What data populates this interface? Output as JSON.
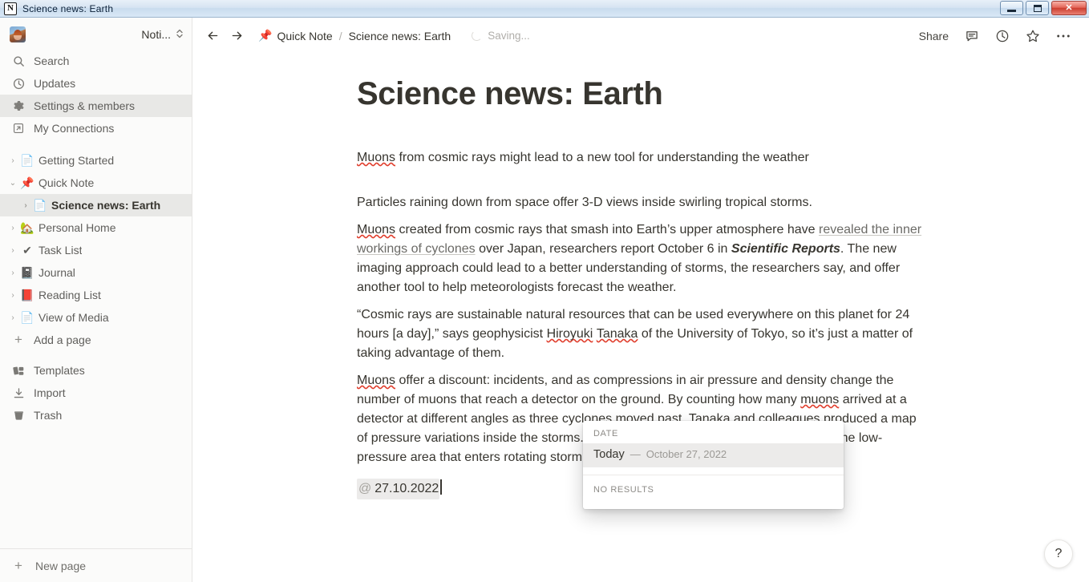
{
  "window": {
    "title": "Science news: Earth",
    "app_icon": "notion-logo-icon",
    "minimize_label": "Minimize",
    "maximize_label": "Restore",
    "close_label": "Close"
  },
  "sidebar": {
    "workspace": {
      "name": "Noti...",
      "avatar": "user-avatar",
      "chevron": "⌃⌄"
    },
    "nav_items": [
      {
        "icon": "search-icon",
        "label": "Search",
        "selected": false
      },
      {
        "icon": "clock-icon",
        "label": "Updates",
        "selected": false
      },
      {
        "icon": "gear-icon",
        "label": "Settings & members",
        "selected": true
      },
      {
        "icon": "link-out-icon",
        "label": "My Connections",
        "selected": false
      }
    ],
    "pages": [
      {
        "icon": "📄",
        "label": "Getting Started",
        "expanded": false,
        "active": false,
        "indented": false
      },
      {
        "icon": "📌",
        "label": "Quick Note",
        "expanded": true,
        "active": false,
        "indented": false
      },
      {
        "icon": "📄",
        "label": "Science news: Earth",
        "expanded": false,
        "active": true,
        "indented": true
      },
      {
        "icon": "🏡",
        "label": "Personal Home",
        "expanded": false,
        "active": false,
        "indented": false
      },
      {
        "icon": "✔",
        "label": "Task List",
        "expanded": false,
        "active": false,
        "indented": false
      },
      {
        "icon": "📓",
        "label": "Journal",
        "expanded": false,
        "active": false,
        "indented": false
      },
      {
        "icon": "📕",
        "label": "Reading List",
        "expanded": false,
        "active": false,
        "indented": false
      },
      {
        "icon": "📄",
        "label": "View of Media",
        "expanded": false,
        "active": false,
        "indented": false
      }
    ],
    "add_page_label": "Add a page",
    "bottom_items": [
      {
        "icon": "templates-icon",
        "label": "Templates"
      },
      {
        "icon": "import-icon",
        "label": "Import"
      },
      {
        "icon": "trash-icon",
        "label": "Trash"
      }
    ],
    "new_page_label": "New page"
  },
  "topbar": {
    "back_label": "Back",
    "forward_label": "Forward",
    "breadcrumb": {
      "parent_icon": "📌",
      "parent": "Quick Note",
      "separator": "/",
      "current": "Science news: Earth"
    },
    "status": "Saving...",
    "share_label": "Share",
    "comments_label": "Comments",
    "updates_label": "Updates",
    "favorite_label": "Favorite",
    "more_label": "More"
  },
  "document": {
    "title": "Science news: Earth",
    "subtitle": {
      "misspelled": "Muons",
      "rest": " from cosmic rays might lead to a new tool for understanding the weather"
    },
    "paragraphs": {
      "p1": "Particles raining down from space offer 3-D views inside swirling tropical storms.",
      "p2_a": "Muons",
      "p2_b": " created from cosmic rays that smash into Earth’s upper atmosphere have ",
      "p2_link": "revealed the inner workings of cyclones",
      "p2_c": " over Japan, researchers report October 6 in ",
      "p2_journal": "Scientific Reports",
      "p2_d": ". The new imaging approach could lead to a better understanding of storms, the researchers say, and offer another tool to help meteorologists forecast the weather.",
      "p3": "“Cosmic rays are sustainable natural resources that can be used everywhere on this planet for 24 hours [a day],” says geophysicist ",
      "p3_name1": "Hiroyuki",
      "p3_name2": "Tanaka",
      "p3_tail": " of the University of Tokyo, so it’s just a matter of taking advantage of them.",
      "p4_a": "Muons",
      "p4_b": " offer a discount: incidents, and as compressions in air pressure and density change the number of muons that reach a detector on the ground. By counting how many ",
      "p4_muons": "muons",
      "p4_c": " arrived at a detector at different angles as three cyclones moved past, ",
      "p4_tanaka": "Tanaka",
      "p4_d": " and colleagues produced a map of pressure variations inside the storms. The approach gave the team an insight into the low-pressure area that enters rotating storm systems."
    },
    "mention": {
      "at": "@",
      "value": "27.10.2022"
    }
  },
  "date_popup": {
    "group_label": "DATE",
    "option_label": "Today",
    "option_dash": "—",
    "option_date": "October 27, 2022",
    "no_results": "NO RESULTS"
  },
  "help": {
    "label": "?"
  },
  "colors": {
    "sidebar_bg": "#fbfbfa",
    "selected_row": "#e8e8e6",
    "text_primary": "#37352f",
    "text_secondary": "#5f5e5b",
    "spellcheck_red": "#e03e2d",
    "accent_pin_red": "#d0342c"
  }
}
